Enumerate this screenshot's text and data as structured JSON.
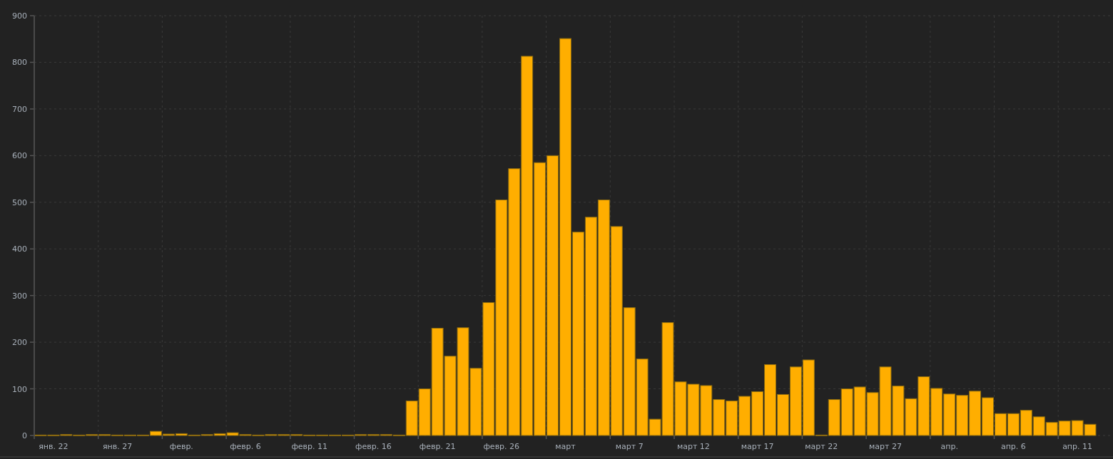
{
  "chart_data": {
    "type": "bar",
    "grid": true,
    "categories": [
      null,
      "янв. 22",
      null,
      null,
      null,
      null,
      "янв. 27",
      null,
      null,
      null,
      null,
      "февр.",
      null,
      null,
      null,
      null,
      "февр. 6",
      null,
      null,
      null,
      null,
      "февр. 11",
      null,
      null,
      null,
      null,
      "февр. 16",
      null,
      null,
      null,
      null,
      "февр. 21",
      null,
      null,
      null,
      null,
      "февр. 26",
      null,
      null,
      null,
      null,
      "март",
      null,
      null,
      null,
      null,
      "март 7",
      null,
      null,
      null,
      null,
      "март 12",
      null,
      null,
      null,
      null,
      "март 17",
      null,
      null,
      null,
      null,
      "март 22",
      null,
      null,
      null,
      null,
      "март 27",
      null,
      null,
      null,
      null,
      "апр.",
      null,
      null,
      null,
      null,
      "апр. 6",
      null,
      null,
      null,
      null,
      "апр. 11",
      null
    ],
    "series": [
      {
        "color": "#ffae00",
        "values": [
          1,
          1,
          2,
          1,
          2,
          2,
          1,
          1,
          1,
          9,
          3,
          4,
          1,
          2,
          4,
          6,
          2,
          1,
          2,
          2,
          2,
          1,
          1,
          1,
          1,
          2,
          2,
          2,
          1,
          74,
          100,
          230,
          170,
          231,
          144,
          285,
          505,
          572,
          813,
          585,
          600,
          851,
          436,
          468,
          505,
          448,
          274,
          164,
          35,
          242,
          115,
          110,
          107,
          77,
          74,
          84,
          94,
          152,
          88,
          147,
          162,
          1,
          77,
          100,
          104,
          92,
          147,
          106,
          79,
          126,
          101,
          89,
          86,
          95,
          81,
          47,
          47,
          54,
          40,
          28,
          31,
          32,
          24
        ]
      }
    ],
    "ylim": [
      0,
      900
    ],
    "yticks": [
      0,
      100,
      200,
      300,
      400,
      500,
      600,
      700,
      800,
      900
    ]
  }
}
